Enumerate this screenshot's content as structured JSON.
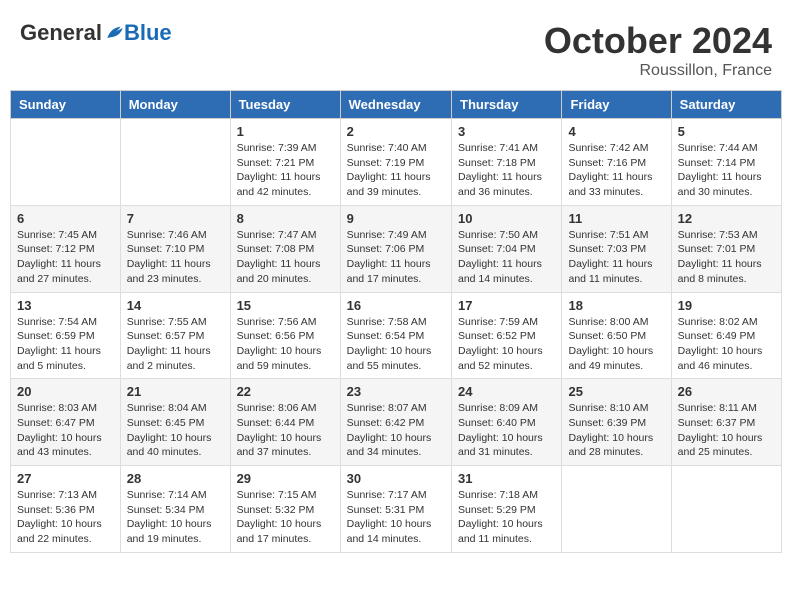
{
  "header": {
    "logo_general": "General",
    "logo_blue": "Blue",
    "month": "October 2024",
    "location": "Roussillon, France"
  },
  "days_of_week": [
    "Sunday",
    "Monday",
    "Tuesday",
    "Wednesday",
    "Thursday",
    "Friday",
    "Saturday"
  ],
  "weeks": [
    [
      {
        "day": "",
        "info": ""
      },
      {
        "day": "",
        "info": ""
      },
      {
        "day": "1",
        "info": "Sunrise: 7:39 AM\nSunset: 7:21 PM\nDaylight: 11 hours and 42 minutes."
      },
      {
        "day": "2",
        "info": "Sunrise: 7:40 AM\nSunset: 7:19 PM\nDaylight: 11 hours and 39 minutes."
      },
      {
        "day": "3",
        "info": "Sunrise: 7:41 AM\nSunset: 7:18 PM\nDaylight: 11 hours and 36 minutes."
      },
      {
        "day": "4",
        "info": "Sunrise: 7:42 AM\nSunset: 7:16 PM\nDaylight: 11 hours and 33 minutes."
      },
      {
        "day": "5",
        "info": "Sunrise: 7:44 AM\nSunset: 7:14 PM\nDaylight: 11 hours and 30 minutes."
      }
    ],
    [
      {
        "day": "6",
        "info": "Sunrise: 7:45 AM\nSunset: 7:12 PM\nDaylight: 11 hours and 27 minutes."
      },
      {
        "day": "7",
        "info": "Sunrise: 7:46 AM\nSunset: 7:10 PM\nDaylight: 11 hours and 23 minutes."
      },
      {
        "day": "8",
        "info": "Sunrise: 7:47 AM\nSunset: 7:08 PM\nDaylight: 11 hours and 20 minutes."
      },
      {
        "day": "9",
        "info": "Sunrise: 7:49 AM\nSunset: 7:06 PM\nDaylight: 11 hours and 17 minutes."
      },
      {
        "day": "10",
        "info": "Sunrise: 7:50 AM\nSunset: 7:04 PM\nDaylight: 11 hours and 14 minutes."
      },
      {
        "day": "11",
        "info": "Sunrise: 7:51 AM\nSunset: 7:03 PM\nDaylight: 11 hours and 11 minutes."
      },
      {
        "day": "12",
        "info": "Sunrise: 7:53 AM\nSunset: 7:01 PM\nDaylight: 11 hours and 8 minutes."
      }
    ],
    [
      {
        "day": "13",
        "info": "Sunrise: 7:54 AM\nSunset: 6:59 PM\nDaylight: 11 hours and 5 minutes."
      },
      {
        "day": "14",
        "info": "Sunrise: 7:55 AM\nSunset: 6:57 PM\nDaylight: 11 hours and 2 minutes."
      },
      {
        "day": "15",
        "info": "Sunrise: 7:56 AM\nSunset: 6:56 PM\nDaylight: 10 hours and 59 minutes."
      },
      {
        "day": "16",
        "info": "Sunrise: 7:58 AM\nSunset: 6:54 PM\nDaylight: 10 hours and 55 minutes."
      },
      {
        "day": "17",
        "info": "Sunrise: 7:59 AM\nSunset: 6:52 PM\nDaylight: 10 hours and 52 minutes."
      },
      {
        "day": "18",
        "info": "Sunrise: 8:00 AM\nSunset: 6:50 PM\nDaylight: 10 hours and 49 minutes."
      },
      {
        "day": "19",
        "info": "Sunrise: 8:02 AM\nSunset: 6:49 PM\nDaylight: 10 hours and 46 minutes."
      }
    ],
    [
      {
        "day": "20",
        "info": "Sunrise: 8:03 AM\nSunset: 6:47 PM\nDaylight: 10 hours and 43 minutes."
      },
      {
        "day": "21",
        "info": "Sunrise: 8:04 AM\nSunset: 6:45 PM\nDaylight: 10 hours and 40 minutes."
      },
      {
        "day": "22",
        "info": "Sunrise: 8:06 AM\nSunset: 6:44 PM\nDaylight: 10 hours and 37 minutes."
      },
      {
        "day": "23",
        "info": "Sunrise: 8:07 AM\nSunset: 6:42 PM\nDaylight: 10 hours and 34 minutes."
      },
      {
        "day": "24",
        "info": "Sunrise: 8:09 AM\nSunset: 6:40 PM\nDaylight: 10 hours and 31 minutes."
      },
      {
        "day": "25",
        "info": "Sunrise: 8:10 AM\nSunset: 6:39 PM\nDaylight: 10 hours and 28 minutes."
      },
      {
        "day": "26",
        "info": "Sunrise: 8:11 AM\nSunset: 6:37 PM\nDaylight: 10 hours and 25 minutes."
      }
    ],
    [
      {
        "day": "27",
        "info": "Sunrise: 7:13 AM\nSunset: 5:36 PM\nDaylight: 10 hours and 22 minutes."
      },
      {
        "day": "28",
        "info": "Sunrise: 7:14 AM\nSunset: 5:34 PM\nDaylight: 10 hours and 19 minutes."
      },
      {
        "day": "29",
        "info": "Sunrise: 7:15 AM\nSunset: 5:32 PM\nDaylight: 10 hours and 17 minutes."
      },
      {
        "day": "30",
        "info": "Sunrise: 7:17 AM\nSunset: 5:31 PM\nDaylight: 10 hours and 14 minutes."
      },
      {
        "day": "31",
        "info": "Sunrise: 7:18 AM\nSunset: 5:29 PM\nDaylight: 10 hours and 11 minutes."
      },
      {
        "day": "",
        "info": ""
      },
      {
        "day": "",
        "info": ""
      }
    ]
  ]
}
